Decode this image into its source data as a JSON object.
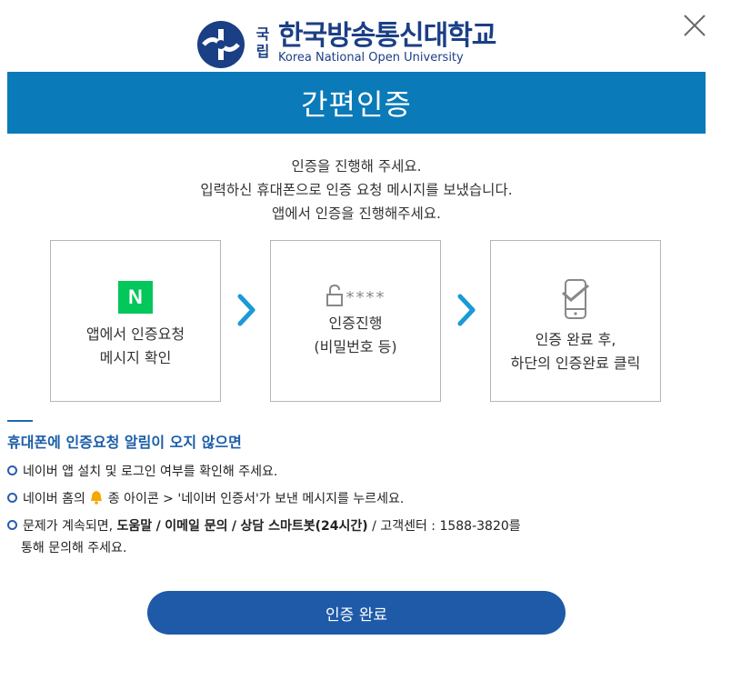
{
  "logo": {
    "prefix_top": "국",
    "prefix_bottom": "립",
    "name_ko": "한국방송통신대학교",
    "name_en": "Korea National Open University"
  },
  "header": {
    "title": "간편인증"
  },
  "intro": {
    "line1": "인증을 진행해 주세요.",
    "line2": "입력하신 휴대폰으로 인증 요청 메시지를 보냈습니다.",
    "line3": "앱에서 인증을 진행해주세요."
  },
  "steps": [
    {
      "line1": "앱에서 인증요청",
      "line2": "메시지 확인",
      "icon": "naver-icon",
      "icon_letter": "N",
      "icon_color": "#03c75a"
    },
    {
      "line1": "인증진행",
      "line2": "(비밀번호 등)",
      "icon": "password-lock-icon",
      "icon_text": "****"
    },
    {
      "line1": "인증 완료 후,",
      "line2": "하단의 인증완료 클릭",
      "icon": "phone-check-icon"
    }
  ],
  "help": {
    "title": "휴대폰에 인증요청 알림이 오지 않으면",
    "bullet1": "네이버 앱 설치 및 로그인 여부를 확인해 주세요.",
    "bullet2_pre": "네이버 홈의",
    "bullet2_post": "종 아이콘 > '네이버 인증서'가 보낸 메시지를 누르세요.",
    "bullet3_pre": "문제가 계속되면,",
    "bullet3_link1": "도움말",
    "bullet3_sep1": "/",
    "bullet3_link2": "이메일 문의",
    "bullet3_sep2": "/",
    "bullet3_link3": "상담 스마트봇(24시간)",
    "bullet3_post": "/ 고객센터 : 1588-3820를",
    "bullet3_line2": "통해 문의해 주세요."
  },
  "footer": {
    "complete_label": "인증 완료"
  },
  "colors": {
    "header_bg": "#0a7ab8",
    "button_bg": "#1e5aa8",
    "arrow": "#1a9ad6",
    "naver_green": "#03c75a",
    "logo_blue": "#1b3f85"
  }
}
